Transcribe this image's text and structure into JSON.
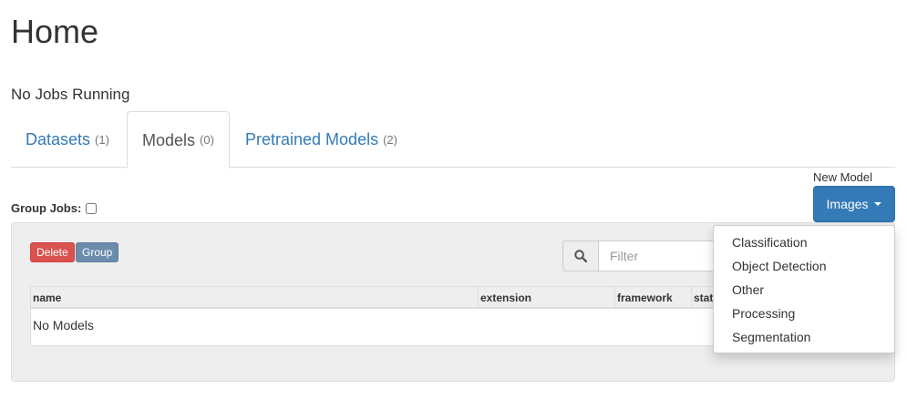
{
  "page": {
    "title": "Home"
  },
  "status": {
    "text": "No Jobs Running"
  },
  "tabs": [
    {
      "label": "Datasets",
      "count": "(1)"
    },
    {
      "label": "Models",
      "count": "(0)"
    },
    {
      "label": "Pretrained Models",
      "count": "(2)"
    }
  ],
  "group_jobs": {
    "label": "Group Jobs:"
  },
  "new_model": {
    "label": "New Model",
    "button": "Images"
  },
  "toolbar": {
    "delete": "Delete",
    "group": "Group"
  },
  "search": {
    "placeholder": "Filter",
    "icon": "search-icon"
  },
  "table": {
    "columns": [
      "name",
      "extension",
      "framework",
      "status"
    ],
    "empty_text": "No Models"
  },
  "dropdown": {
    "items": [
      "Classification",
      "Object Detection",
      "Other",
      "Processing",
      "Segmentation"
    ]
  },
  "colors": {
    "primary": "#337ab7",
    "danger": "#d9534f",
    "group": "#6c8cad"
  }
}
